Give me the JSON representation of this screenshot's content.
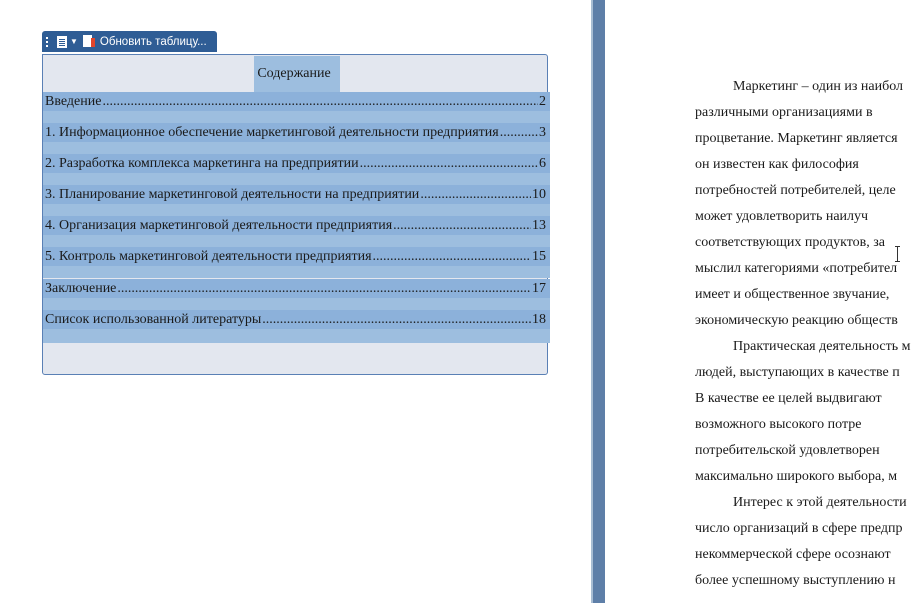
{
  "toc_toolbar": {
    "update_label": "Обновить таблицу..."
  },
  "toc": {
    "title": "Содержание",
    "entries": [
      {
        "text": "Введение",
        "page": "2"
      },
      {
        "text": "1. Информационное обеспечение маркетинговой деятельности предприятия",
        "page": "3"
      },
      {
        "text": "2. Разработка комплекса маркетинга на предприятии",
        "page": "6"
      },
      {
        "text": "3. Планирование маркетинговой деятельности на предприятии",
        "page": "10"
      },
      {
        "text": "4. Организация маркетинговой деятельности предприятия",
        "page": "13"
      },
      {
        "text": "5.  Контроль маркетинговой деятельности предприятия",
        "page": "15"
      },
      {
        "text": "Заключение",
        "page": "17"
      },
      {
        "text": "Список использованной литературы",
        "page": "18"
      }
    ]
  },
  "body_text": {
    "lines": [
      "Маркетинг – один из наибол",
      "различными организациями в",
      "процветание. Маркетинг является",
      "он известен как философия",
      "потребностей потребителей, целе",
      "может удовлетворить наилуч",
      "соответствующих продуктов, за",
      "мыслил категориями «потребител",
      "имеет и общественное звучание,",
      "экономическую реакцию обществ",
      "Практическая деятельность м",
      "людей, выступающих в качестве п",
      "В качестве ее целей выдвигают",
      "возможного высокого потре",
      "потребительской удовлетворен",
      "максимально широкого выбора, м",
      "Интерес к этой деятельности",
      "число организаций в сфере предпр",
      "некоммерческой сфере осознают",
      "более успешному выступлению н"
    ]
  },
  "colors": {
    "toolbar": "#2f5d95",
    "selection": "#8cb1da",
    "frame_border": "#5a80b5",
    "divider": "#5e7fa8"
  }
}
